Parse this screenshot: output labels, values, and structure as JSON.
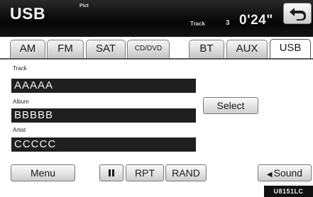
{
  "header": {
    "source_title": "USB",
    "pict_label": "Pict",
    "track_label": "Track",
    "track_number": "3",
    "time": "0'24\"",
    "back_icon": "return-arrow-icon"
  },
  "tabs": [
    {
      "label": "AM",
      "active": false
    },
    {
      "label": "FM",
      "active": false
    },
    {
      "label": "SAT",
      "active": false
    },
    {
      "label": "CD/DVD",
      "active": false
    },
    {
      "label": "BT",
      "active": false
    },
    {
      "label": "AUX",
      "active": false
    },
    {
      "label": "USB",
      "active": true
    }
  ],
  "fields": {
    "track": {
      "label": "Track",
      "value": "AAAAA"
    },
    "album": {
      "label": "Album",
      "value": "BBBBB"
    },
    "artist": {
      "label": "Artist",
      "value": "CCCCC"
    }
  },
  "buttons": {
    "select": "Select",
    "menu": "Menu",
    "pause_icon": "pause-icon",
    "rpt": "RPT",
    "rand": "RAND",
    "sound": "Sound",
    "sound_icon": "left-triangle-icon"
  },
  "image_code": "U8151LC"
}
